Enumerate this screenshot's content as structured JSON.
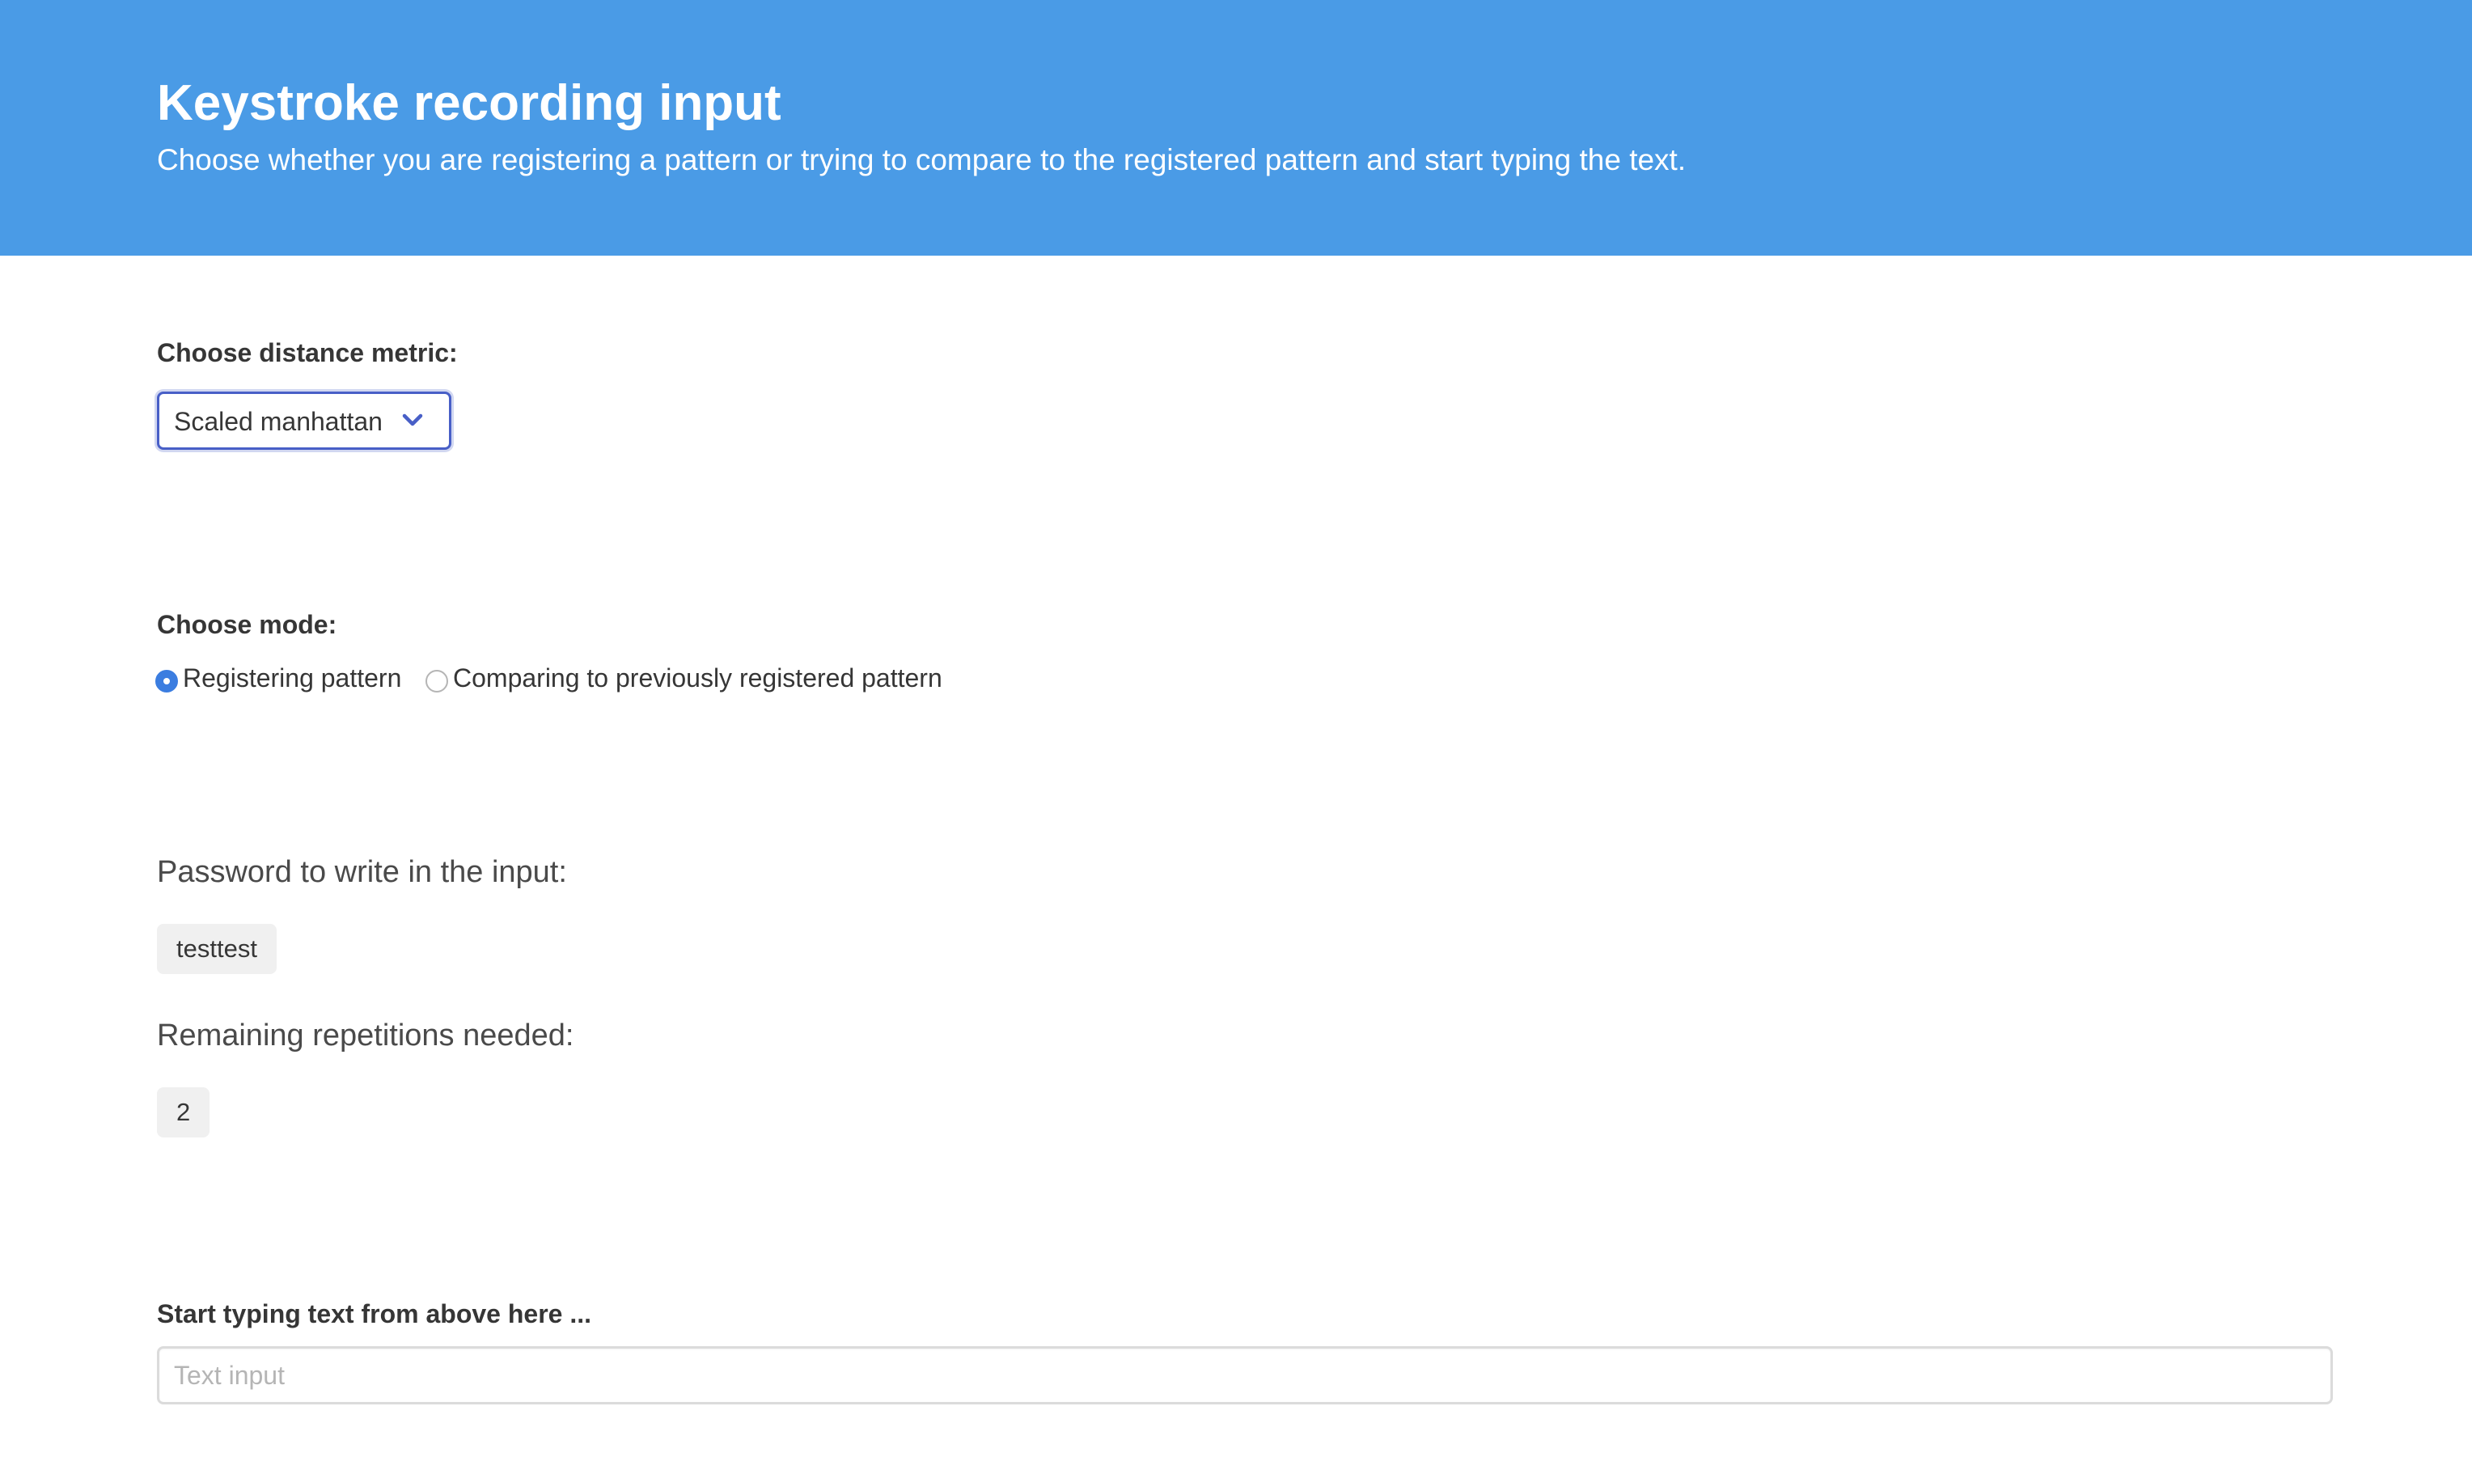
{
  "header": {
    "title": "Keystroke recording input",
    "subtitle": "Choose whether you are registering a pattern or trying to compare to the registered pattern and start typing the text.",
    "background_color": "#4a9be6"
  },
  "metric": {
    "label": "Choose distance metric:",
    "selected": "Scaled manhattan",
    "icon": "chevron-down-icon"
  },
  "mode": {
    "label": "Choose mode:",
    "options": [
      {
        "label": "Registering pattern",
        "checked": true
      },
      {
        "label": "Comparing to previously registered pattern",
        "checked": false
      }
    ],
    "accent_color": "#3b7de0"
  },
  "password": {
    "label": "Password to write in the input:",
    "value": "testtest"
  },
  "repetitions": {
    "label": "Remaining repetitions needed:",
    "value": "2"
  },
  "typing": {
    "label": "Start typing text from above here ...",
    "placeholder": "Text input",
    "value": ""
  }
}
